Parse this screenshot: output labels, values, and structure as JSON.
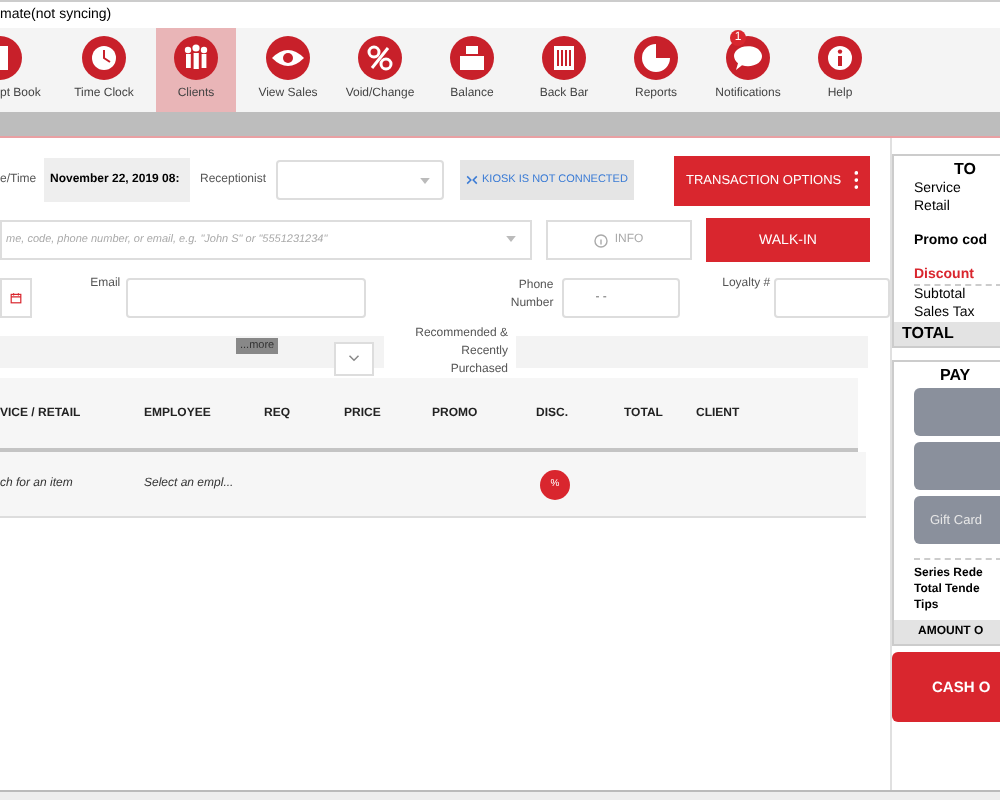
{
  "window": {
    "title": "mate(not syncing)"
  },
  "toolbar": [
    {
      "label": "pt Book",
      "kind": "book",
      "selected": false
    },
    {
      "label": "Time Clock",
      "kind": "clock",
      "selected": false
    },
    {
      "label": "Clients",
      "kind": "people",
      "selected": true
    },
    {
      "label": "View Sales",
      "kind": "eye",
      "selected": false
    },
    {
      "label": "Void/Change",
      "kind": "percent",
      "selected": false
    },
    {
      "label": "Balance",
      "kind": "register",
      "selected": false
    },
    {
      "label": "Back Bar",
      "kind": "barcode",
      "selected": false
    },
    {
      "label": "Reports",
      "kind": "pie",
      "selected": false
    },
    {
      "label": "Notifications",
      "kind": "chat",
      "selected": false,
      "badge": "1"
    },
    {
      "label": "Help",
      "kind": "info",
      "selected": false
    }
  ],
  "form": {
    "date_label": "e/Time",
    "date_value": "November 22, 2019 08:",
    "receptionist_label": "Receptionist",
    "kiosk": "KIOSK IS NOT CONNECTED",
    "transaction_options": "TRANSACTION OPTIONS",
    "search_placeholder": "me, code, phone number, or email, e.g. \"John S\" or \"5551231234\"",
    "info": "INFO",
    "walk_in": "WALK-IN",
    "email_label": "Email",
    "phone_label": "Phone Number",
    "phone_value": "-  -",
    "loyalty_label": "Loyalty #",
    "more": "...more",
    "recommended_label": "Recommended & Recently Purchased"
  },
  "table": {
    "columns": [
      "VICE / RETAIL",
      "EMPLOYEE",
      "REQ",
      "PRICE",
      "PROMO",
      "DISC.",
      "TOTAL",
      "CLIENT"
    ],
    "rows": [
      {
        "item": "ch for an item",
        "employee": "Select an empl...",
        "discount_mark": "%"
      }
    ]
  },
  "totals": {
    "title": "TO",
    "lines": [
      {
        "label": "Service",
        "kind": "plain"
      },
      {
        "label": "Retail",
        "kind": "plain"
      },
      {
        "label": "Promo cod",
        "kind": "bold"
      },
      {
        "label": "Discount",
        "kind": "alert"
      },
      {
        "label": "Subtotal",
        "kind": "plain"
      },
      {
        "label": "Sales Tax",
        "kind": "plain"
      }
    ],
    "total": "TOTAL"
  },
  "payment": {
    "title": "PAY",
    "buttons": [
      {
        "kind": "blank"
      },
      {
        "kind": "blank"
      },
      {
        "kind": "labeled",
        "label": "Gift Card"
      }
    ],
    "lines": [
      "Series Rede",
      "Total Tende",
      "Tips"
    ],
    "amount": "AMOUNT O",
    "cash_out": "CASH O"
  }
}
